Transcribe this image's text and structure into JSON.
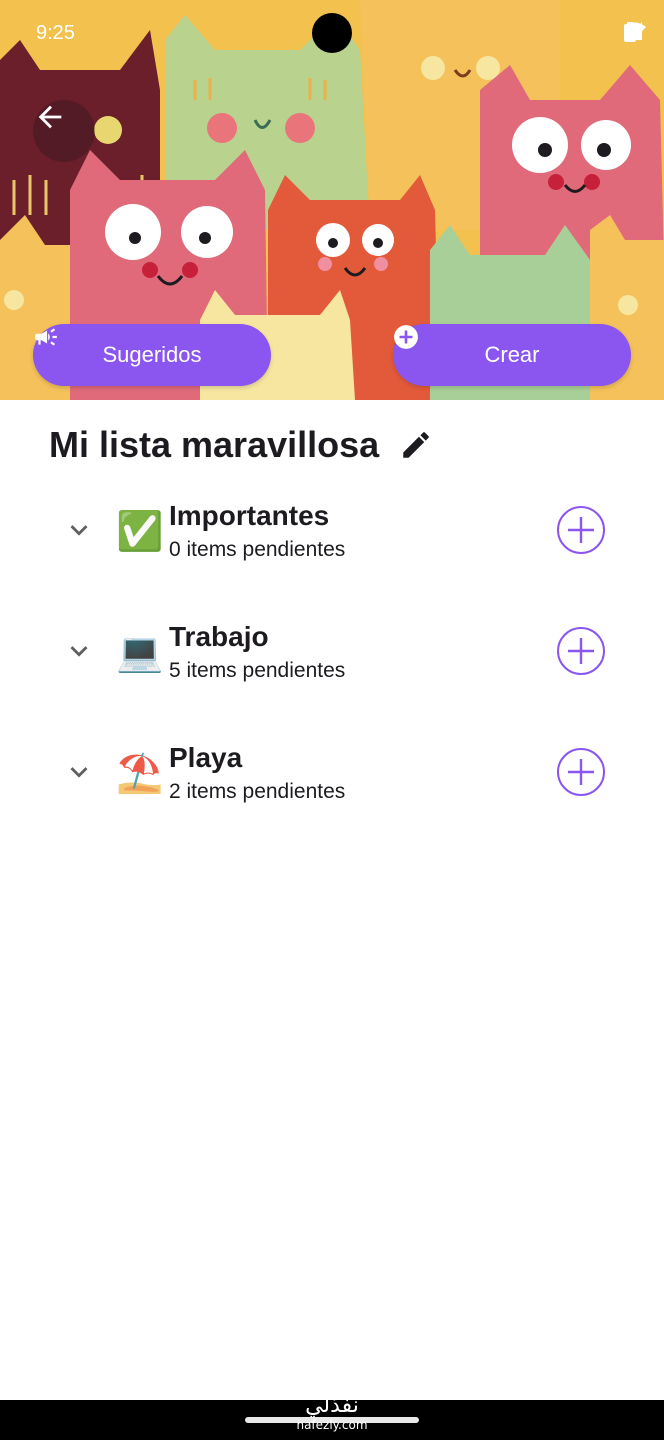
{
  "status_bar": {
    "time": "9:25"
  },
  "hero": {
    "image": "illustrated-cats-pattern",
    "back_icon": "arrow-back-icon"
  },
  "actions": {
    "suggested_label": "Sugeridos",
    "suggested_icon": "megaphone-icon",
    "create_label": "Crear",
    "create_icon": "plus-circle-icon"
  },
  "list": {
    "title": "Mi lista maravillosa",
    "edit_icon": "pencil-icon"
  },
  "categories": [
    {
      "emoji": "✅",
      "name": "Importantes",
      "pending": "0 items pendientes"
    },
    {
      "emoji": "💻",
      "name": "Trabajo",
      "pending": "5 items pendientes"
    },
    {
      "emoji": "⛱️",
      "name": "Playa",
      "pending": "2 items pendientes"
    }
  ],
  "colors": {
    "accent": "#8b55f0",
    "text": "#1d1b20"
  },
  "watermark": {
    "arabic": "نفذلي",
    "domain": "nafezly.com"
  }
}
